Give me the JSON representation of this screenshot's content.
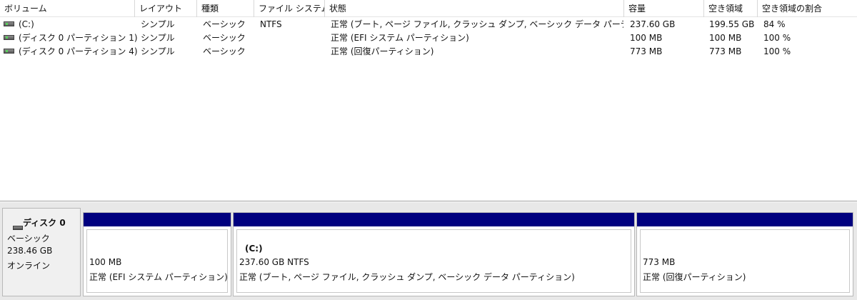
{
  "columns": [
    "ボリューム",
    "レイアウト",
    "種類",
    "ファイル システム",
    "状態",
    "容量",
    "空き領域",
    "空き領域の割合"
  ],
  "volumes": [
    {
      "name": "(C:)",
      "layout": "シンプル",
      "type": "ベーシック",
      "fs": "NTFS",
      "status": "正常 (ブート, ページ ファイル, クラッシュ ダンプ, ベーシック データ パーティション)",
      "capacity": "237.60 GB",
      "free": "199.55 GB",
      "free_pct": "84 %"
    },
    {
      "name": "(ディスク 0 パーティション 1)",
      "layout": "シンプル",
      "type": "ベーシック",
      "fs": "",
      "status": "正常 (EFI システム パーティション)",
      "capacity": "100 MB",
      "free": "100 MB",
      "free_pct": "100 %"
    },
    {
      "name": "(ディスク 0 パーティション 4)",
      "layout": "シンプル",
      "type": "ベーシック",
      "fs": "",
      "status": "正常 (回復パーティション)",
      "capacity": "773 MB",
      "free": "773 MB",
      "free_pct": "100 %"
    }
  ],
  "disk": {
    "name": "ディスク 0",
    "type": "ベーシック",
    "size": "238.46 GB",
    "state": "オンライン",
    "partitions": [
      {
        "label": "",
        "size": "100 MB",
        "status": "正常 (EFI システム パーティション)"
      },
      {
        "label": "(C:)",
        "size": "237.60 GB NTFS",
        "status": "正常 (ブート, ページ ファイル, クラッシュ ダンプ, ベーシック データ パーティション)"
      },
      {
        "label": "",
        "size": "773 MB",
        "status": "正常 (回復パーティション)"
      }
    ]
  },
  "colors": {
    "partition_bar": "#00007f",
    "pane_bg": "#e8e8e8"
  },
  "icons": {
    "volume": "drive-icon",
    "disk": "disk-icon"
  }
}
